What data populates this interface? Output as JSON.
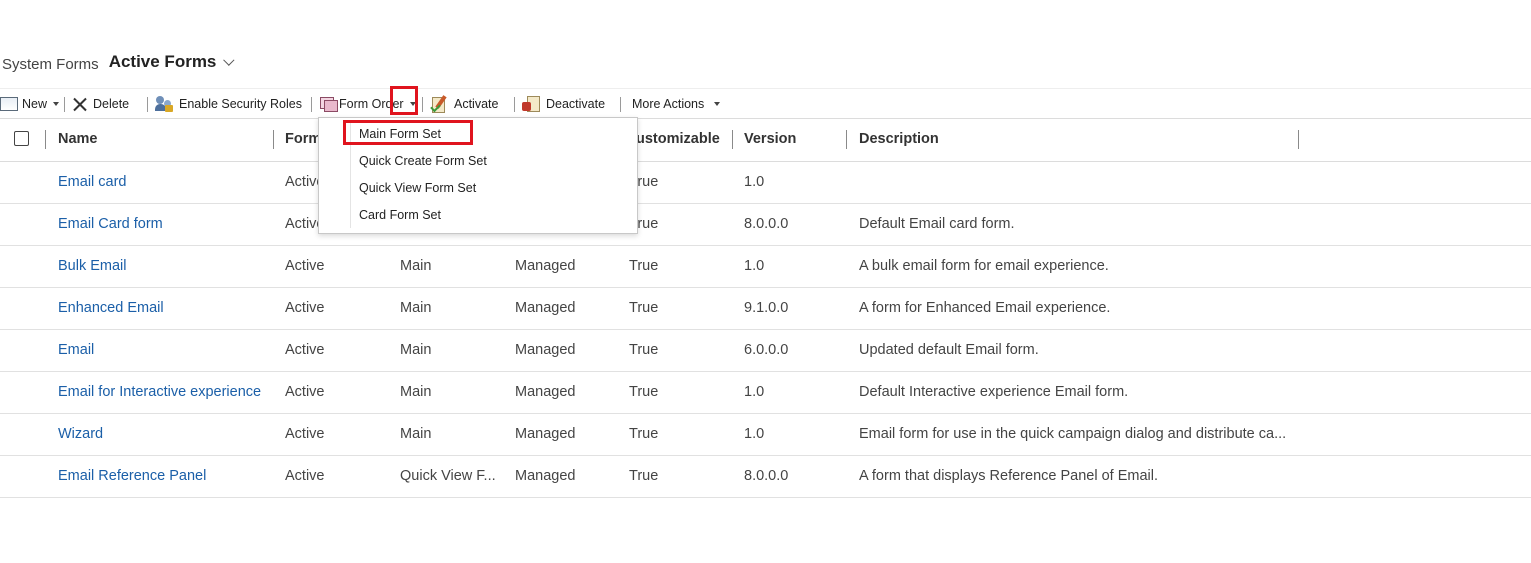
{
  "header": {
    "view_label": "System Forms",
    "view_name": "Active Forms"
  },
  "toolbar": {
    "new_label": "New",
    "delete_label": "Delete",
    "enable_security_roles_label": "Enable Security Roles",
    "form_order_label": "Form Order",
    "activate_label": "Activate",
    "deactivate_label": "Deactivate",
    "more_actions_label": "More Actions"
  },
  "form_order_menu": {
    "items": [
      "Main Form Set",
      "Quick Create Form Set",
      "Quick View Form Set",
      "Card Form Set"
    ]
  },
  "grid": {
    "columns": [
      "Name",
      "Form",
      "ustomizable",
      "Version",
      "Description"
    ],
    "rows": [
      {
        "name": "Email card",
        "status": "Active",
        "form_type": "",
        "state": "",
        "customizable": "True",
        "version": "1.0",
        "description": ""
      },
      {
        "name": "Email Card form",
        "status": "Active",
        "form_type": "",
        "state": "",
        "customizable": "True",
        "version": "8.0.0.0",
        "description": "Default Email card form."
      },
      {
        "name": "Bulk Email",
        "status": "Active",
        "form_type": "Main",
        "state": "Managed",
        "customizable": "True",
        "version": "1.0",
        "description": "A bulk email form for email experience."
      },
      {
        "name": "Enhanced Email",
        "status": "Active",
        "form_type": "Main",
        "state": "Managed",
        "customizable": "True",
        "version": "9.1.0.0",
        "description": "A form for Enhanced Email experience."
      },
      {
        "name": "Email",
        "status": "Active",
        "form_type": "Main",
        "state": "Managed",
        "customizable": "True",
        "version": "6.0.0.0",
        "description": "Updated default Email form."
      },
      {
        "name": "Email for Interactive experience",
        "status": "Active",
        "form_type": "Main",
        "state": "Managed",
        "customizable": "True",
        "version": "1.0",
        "description": "Default Interactive experience Email form."
      },
      {
        "name": "Wizard",
        "status": "Active",
        "form_type": "Main",
        "state": "Managed",
        "customizable": "True",
        "version": "1.0",
        "description": "Email form for use in the quick campaign dialog and distribute ca..."
      },
      {
        "name": "Email Reference Panel",
        "status": "Active",
        "form_type": "Quick View F...",
        "state": "Managed",
        "customizable": "True",
        "version": "8.0.0.0",
        "description": "A form that displays Reference Panel of Email."
      }
    ]
  },
  "colors": {
    "link": "#1b5fa8",
    "highlight": "#e0141e"
  }
}
